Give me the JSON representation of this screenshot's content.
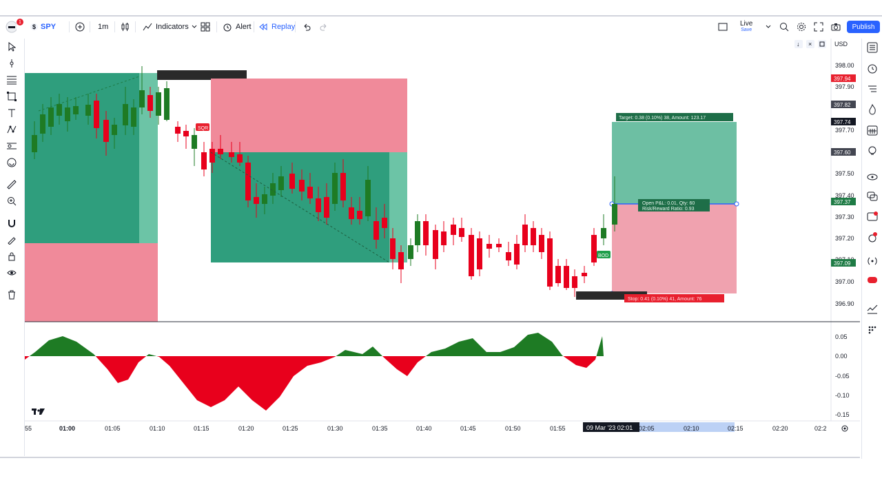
{
  "toolbar": {
    "symbol": "SPY",
    "symbol_prefix": "$",
    "interval": "1m",
    "indicators_label": "Indicators",
    "alert_label": "Alert",
    "replay_label": "Replay",
    "live_label": "Live",
    "save_label": "Save",
    "publish_label": "Publish",
    "notification_count": "1"
  },
  "currency": "USD",
  "price_axis": {
    "ticks": [
      "398.00",
      "397.90",
      "397.70",
      "397.50",
      "397.40",
      "397.30",
      "397.20",
      "397.10",
      "397.00",
      "396.90"
    ],
    "badges": [
      {
        "label": "397.94",
        "color": "#e8202e"
      },
      {
        "label": "397.82",
        "color": "#434651"
      },
      {
        "label": "397.74",
        "color": "#131722"
      },
      {
        "label": "397.60",
        "color": "#434651"
      },
      {
        "label": "397.37",
        "color": "#1e7b45"
      },
      {
        "label": "397.09",
        "color": "#1e7b45"
      }
    ]
  },
  "osc_axis": {
    "ticks": [
      "0.05",
      "0.00",
      "-0.05",
      "-0.10",
      "-0.15"
    ]
  },
  "time_axis": {
    "ticks": [
      "55",
      "01:00",
      "01:05",
      "01:10",
      "01:15",
      "01:20",
      "01:25",
      "01:30",
      "01:35",
      "01:40",
      "01:45",
      "01:50",
      "01:55",
      "02:05",
      "02:10",
      "02:15",
      "02:20",
      "02:2"
    ],
    "cursor_label": "09 Mar '23   02:01"
  },
  "labels": {
    "sqr": "SQR",
    "bod": "BOD",
    "target": "Target: 0.38 (0.10%) 38, Amount: 123.17",
    "open_pl": "Open P&L: 0.01, Qty: 60",
    "risk_reward": "Risk/Reward Ratio: 0.93",
    "stop": "Stop: 0.41 (0.10%) 41, Amount: 76"
  },
  "colors": {
    "up": "#1e7b24",
    "down": "#e8001c",
    "profit_zone": "#2f9e7d",
    "loss_zone": "#f08a9a",
    "accent": "#2962ff"
  }
}
